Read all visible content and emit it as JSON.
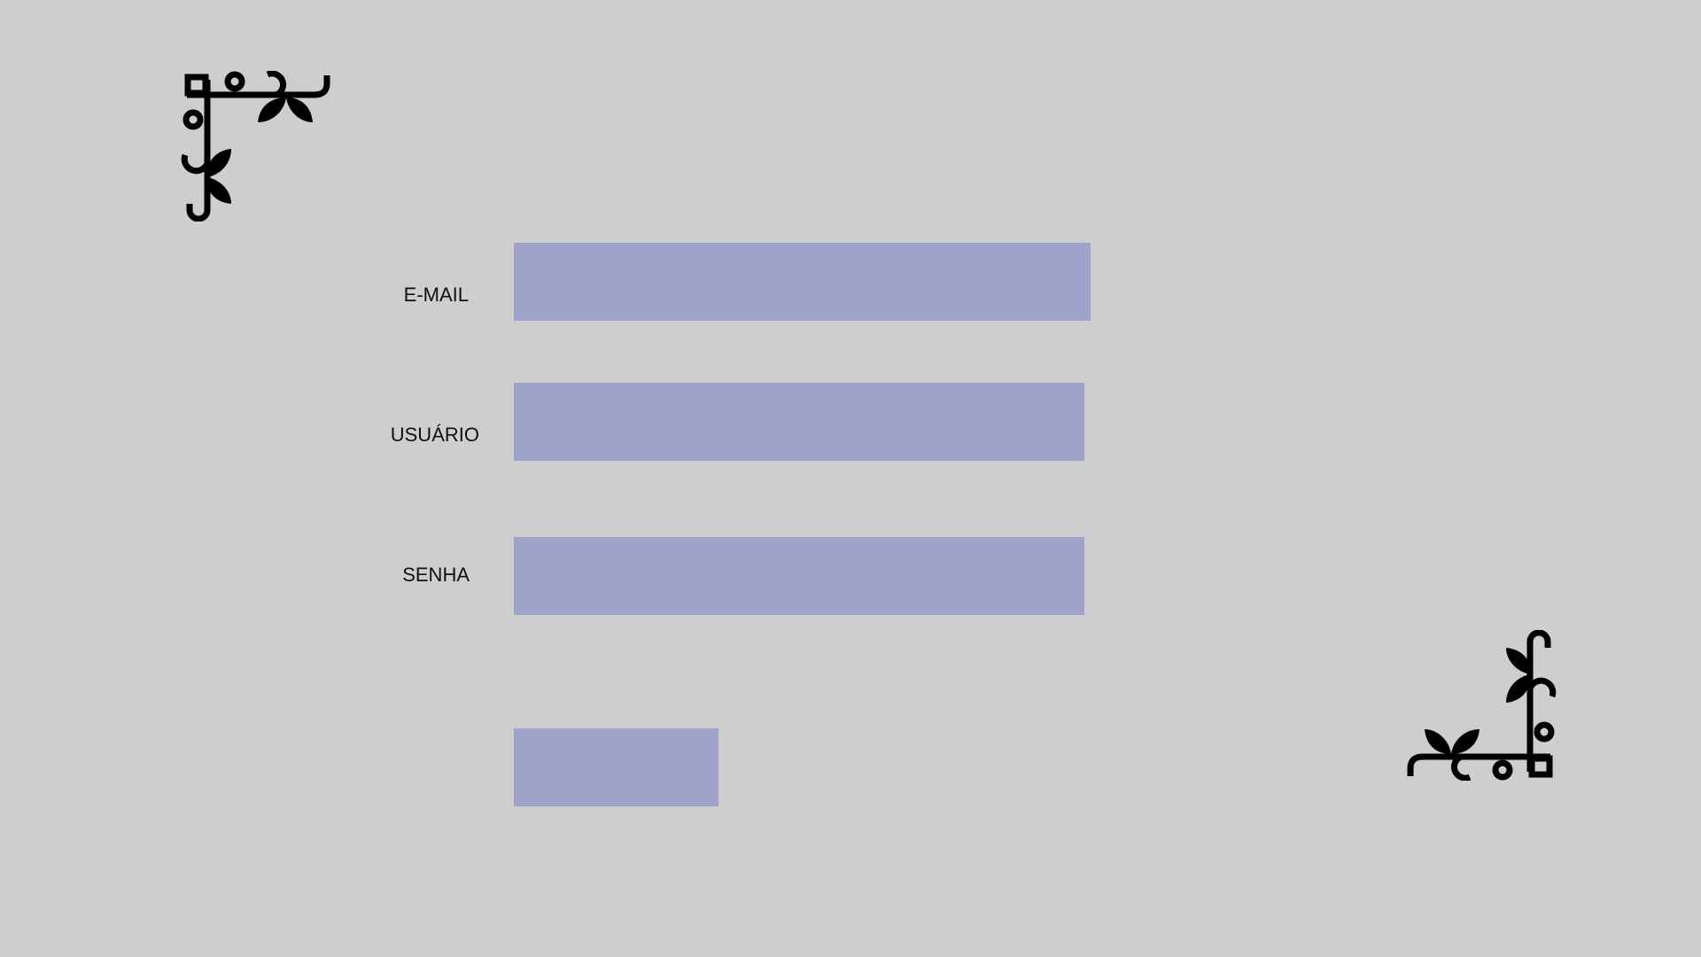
{
  "colors": {
    "background": "#cecece",
    "field": "#9fa3c9",
    "ornament": "#000000"
  },
  "ornaments": {
    "top_left": "corner-flourish-icon",
    "bottom_right": "corner-flourish-icon"
  },
  "form": {
    "email": {
      "label": "E-MAIL",
      "value": ""
    },
    "username": {
      "label": "USUÁRIO",
      "value": ""
    },
    "password": {
      "label": "SENHA",
      "value": ""
    },
    "submit_label": ""
  }
}
